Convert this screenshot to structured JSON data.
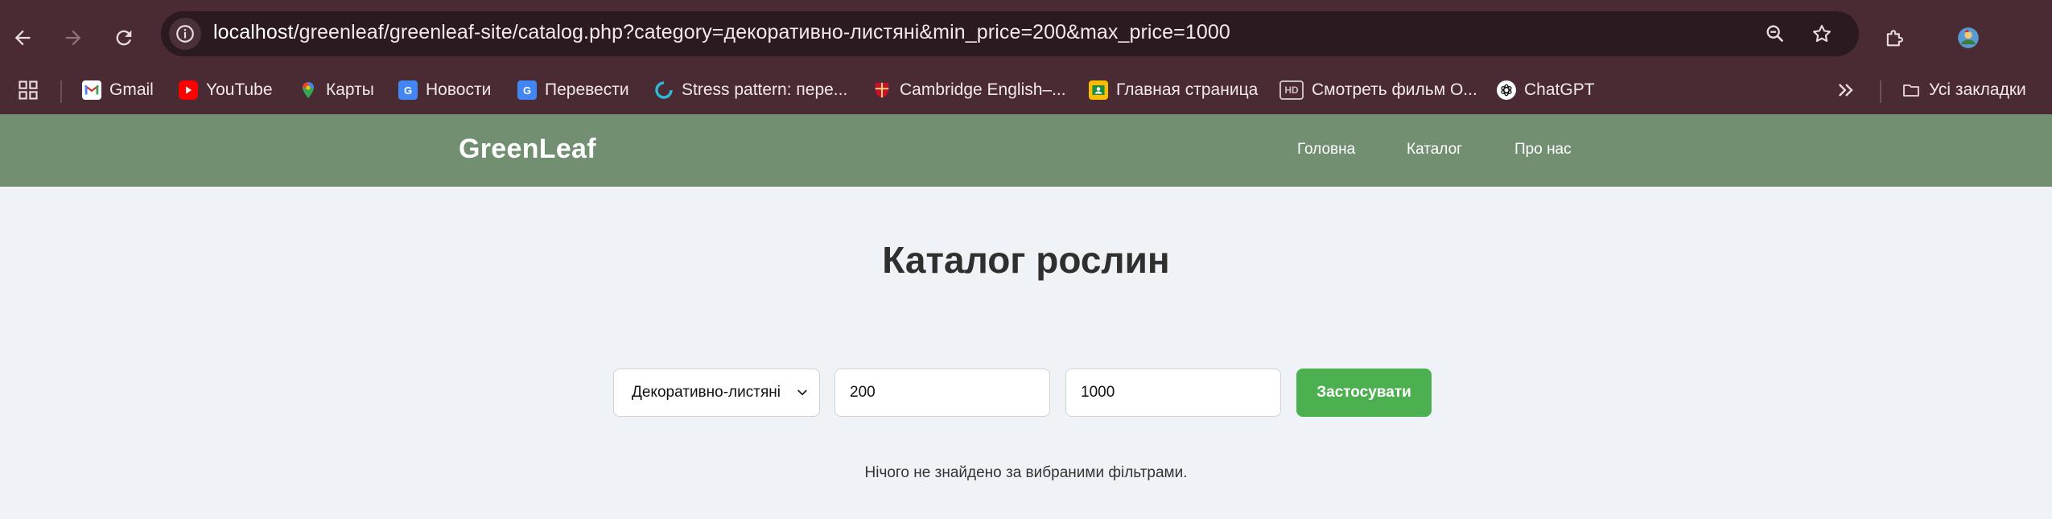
{
  "browser": {
    "url_host": "localhost",
    "url_path": "/greenleaf/greenleaf-site/catalog.php?category=декоративно-листяні&min_price=200&max_price=1000",
    "bookmarks": [
      {
        "label": "Gmail",
        "icon": "gmail-icon"
      },
      {
        "label": "YouTube",
        "icon": "youtube-icon"
      },
      {
        "label": "Карты",
        "icon": "maps-icon"
      },
      {
        "label": "Новости",
        "icon": "news-icon"
      },
      {
        "label": "Перевести",
        "icon": "translate-icon"
      },
      {
        "label": "Stress pattern: пере...",
        "icon": "stress-pattern-icon"
      },
      {
        "label": "Cambridge English–...",
        "icon": "cambridge-icon"
      },
      {
        "label": "Главная страница",
        "icon": "classroom-icon"
      },
      {
        "label": "Смотреть фильм О...",
        "icon": "hd-icon"
      },
      {
        "label": "ChatGPT",
        "icon": "chatgpt-icon"
      }
    ],
    "all_bookmarks_label": "Усі закладки"
  },
  "site": {
    "logo": "GreenLeaf",
    "nav": [
      "Головна",
      "Каталог",
      "Про нас"
    ],
    "header_color": "#728f72"
  },
  "catalog": {
    "title": "Каталог рослин",
    "category_selected": "Декоративно-листяні",
    "min_price": "200",
    "max_price": "1000",
    "apply_label": "Застосувати",
    "apply_color": "#4caf50",
    "empty_message": "Нічого не знайдено за вибраними фільтрами."
  }
}
